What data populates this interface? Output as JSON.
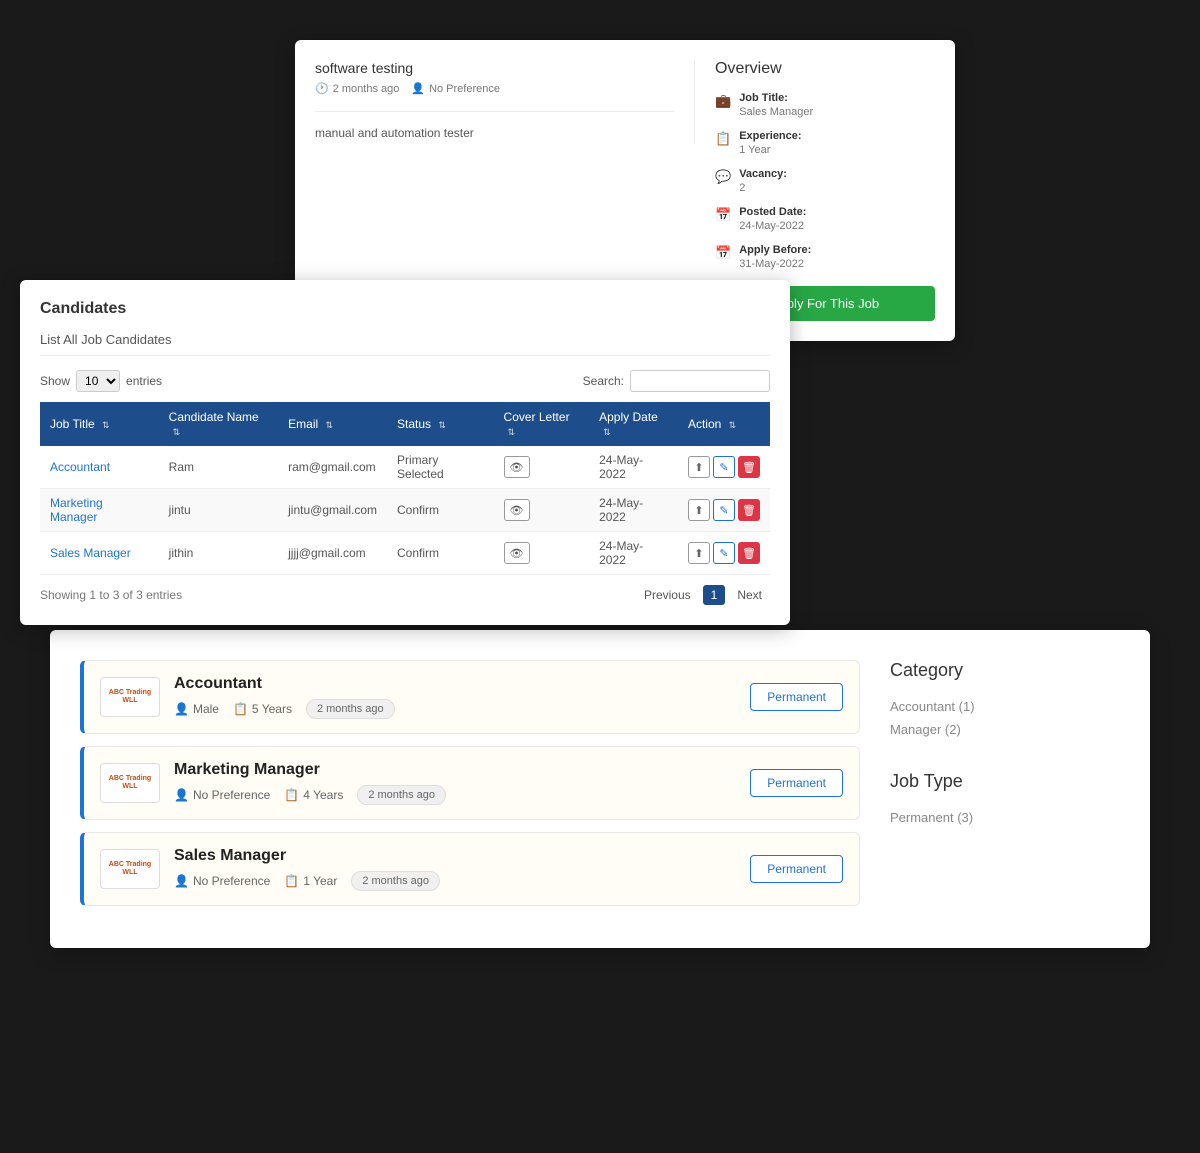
{
  "jobDetail": {
    "title": "software testing",
    "timeAgo": "2 months ago",
    "preference": "No Preference",
    "description": "manual and automation tester",
    "overview": {
      "title": "Overview",
      "jobTitle": {
        "label": "Job Title:",
        "value": "Sales Manager"
      },
      "experience": {
        "label": "Experience:",
        "value": "1 Year"
      },
      "vacancy": {
        "label": "Vacancy:",
        "value": "2"
      },
      "postedDate": {
        "label": "Posted Date:",
        "value": "24-May-2022"
      },
      "applyBefore": {
        "label": "Apply Before:",
        "value": "31-May-2022"
      },
      "applyBtn": "Apply For This Job"
    }
  },
  "candidates": {
    "pageTitle": "Candidates",
    "listLabel": "List All Job Candidates",
    "show": "Show",
    "entries": "entries",
    "showCount": "10",
    "search": "Search:",
    "table": {
      "headers": [
        "Job Title",
        "Candidate Name",
        "Email",
        "Status",
        "Cover Letter",
        "Apply Date",
        "Action"
      ],
      "rows": [
        {
          "jobTitle": "Accountant",
          "candidateName": "Ram",
          "email": "ram@gmail.com",
          "status": "Primary Selected",
          "applyDate": "24-May-2022"
        },
        {
          "jobTitle": "Marketing Manager",
          "candidateName": "jintu",
          "email": "jintu@gmail.com",
          "status": "Confirm",
          "applyDate": "24-May-2022"
        },
        {
          "jobTitle": "Sales Manager",
          "candidateName": "jithin",
          "email": "jjjj@gmail.com",
          "status": "Confirm",
          "applyDate": "24-May-2022"
        }
      ]
    },
    "footer": {
      "showing": "Showing 1 to 3 of 3 entries",
      "previous": "Previous",
      "next": "Next",
      "activePage": "1"
    }
  },
  "listings": {
    "jobs": [
      {
        "company": "ABC Trading WLL",
        "title": "Accountant",
        "gender": "Male",
        "experience": "5 Years",
        "timeAgo": "2 months ago",
        "jobType": "Permanent"
      },
      {
        "company": "ABC Trading WLL",
        "title": "Marketing Manager",
        "gender": "No Preference",
        "experience": "4 Years",
        "timeAgo": "2 months ago",
        "jobType": "Permanent"
      },
      {
        "company": "ABC Trading WLL",
        "title": "Sales Manager",
        "gender": "No Preference",
        "experience": "1 Year",
        "timeAgo": "2 months ago",
        "jobType": "Permanent"
      }
    ],
    "sidebar": {
      "categoryTitle": "Category",
      "categories": [
        "Accountant (1)",
        "Manager (2)"
      ],
      "jobTypeTitle": "Job Type",
      "jobTypes": [
        "Permanent (3)"
      ]
    }
  },
  "icons": {
    "clock": "🕐",
    "user": "👤",
    "briefcase": "💼",
    "calendar": "📅",
    "eye": "👁",
    "edit": "✎",
    "delete": "🗑",
    "upload": "⬆"
  }
}
